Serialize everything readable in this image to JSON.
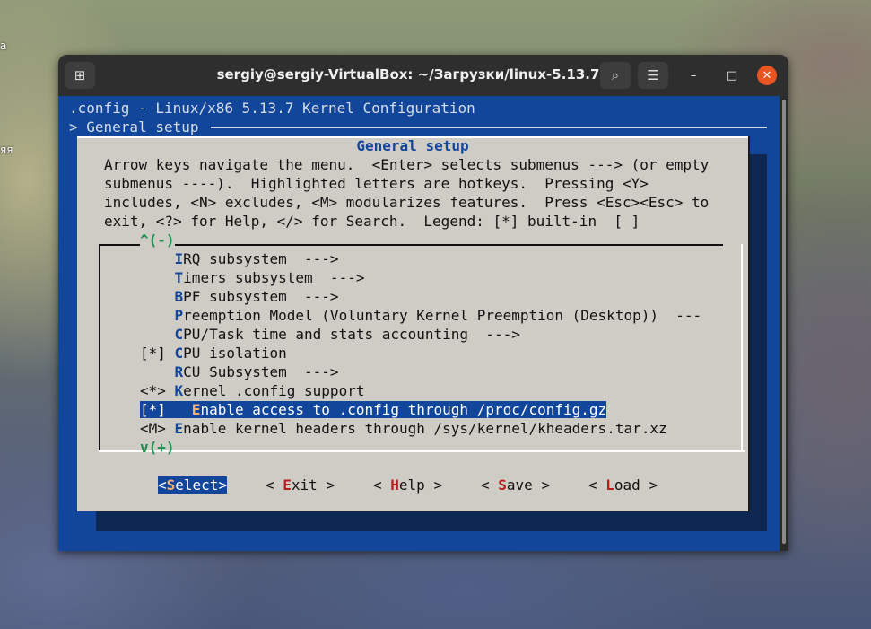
{
  "desktop": {
    "fragment_top": "а",
    "fragment_mid": "яя"
  },
  "window": {
    "title": "sergiy@sergiy-VirtualBox: ~/Загрузки/linux-5.13.7",
    "buttons": {
      "new_tab": "⊞",
      "search": "⌕",
      "menu": "☰",
      "minimize": "–",
      "maximize": "□",
      "close": "✕"
    }
  },
  "terminal": {
    "config_line": ".config - Linux/x86 5.13.7 Kernel Configuration",
    "breadcrumb": "> General setup",
    "dialog": {
      "title": "General setup",
      "help_lines": [
        "Arrow keys navigate the menu.  <Enter> selects submenus ---> (or empty",
        "submenus ----).  Highlighted letters are hotkeys.  Pressing <Y>",
        "includes, <N> excludes, <M> modularizes features.  Press <Esc><Esc> to",
        "exit, <?> for Help, </> for Search.  Legend: [*] built-in  [ ]"
      ],
      "scroll_up": "^(-)",
      "scroll_down": "v(+)",
      "items": [
        {
          "prefix": "    ",
          "hotkey": "I",
          "rest": "RQ subsystem  --->"
        },
        {
          "prefix": "    ",
          "hotkey": "T",
          "rest": "imers subsystem  --->"
        },
        {
          "prefix": "    ",
          "hotkey": "B",
          "rest": "PF subsystem  --->"
        },
        {
          "prefix": "    ",
          "hotkey": "P",
          "rest": "reemption Model (Voluntary Kernel Preemption (Desktop))  ---"
        },
        {
          "prefix": "    ",
          "hotkey": "C",
          "rest": "PU/Task time and stats accounting  --->"
        },
        {
          "prefix": "[*] ",
          "hotkey": "C",
          "rest": "PU isolation"
        },
        {
          "prefix": "    ",
          "hotkey": "R",
          "rest": "CU Subsystem  --->"
        },
        {
          "prefix": "<*> ",
          "hotkey": "K",
          "rest": "ernel .config support"
        },
        {
          "prefix": "[*]   ",
          "hotkey": "E",
          "rest": "nable access to .config through /proc/config.gz"
        },
        {
          "prefix": "<M> ",
          "hotkey": "E",
          "rest": "nable kernel headers through /sys/kernel/kheaders.tar.xz"
        }
      ],
      "selected_index": 8,
      "buttons": [
        {
          "open": "<",
          "hotkey": "S",
          "rest": "elect",
          "close": ">"
        },
        {
          "open": "< ",
          "hotkey": "E",
          "rest": "xit",
          "close": " >"
        },
        {
          "open": "< ",
          "hotkey": "H",
          "rest": "elp",
          "close": " >"
        },
        {
          "open": "< ",
          "hotkey": "S",
          "rest": "ave",
          "close": " >"
        },
        {
          "open": "< ",
          "hotkey": "L",
          "rest": "oad",
          "close": " >"
        }
      ]
    }
  }
}
